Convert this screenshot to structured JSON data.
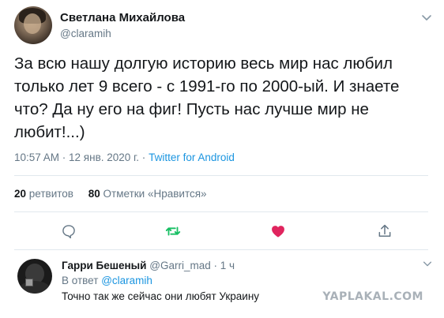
{
  "tweet": {
    "author_name": "Светлана Михайлова",
    "author_handle": "@claramih",
    "text": "За всю нашу долгую историю весь мир нас любил только лет 9 всего - с 1991-го по 2000-ый. И знаете что? Да ну его на фиг!  Пусть нас лучше мир не любит!...)",
    "time": "10:57 AM · 12 янв. 2020 г. · ",
    "source": "Twitter for Android",
    "retweets_count": "20",
    "retweets_label": "ретвитов",
    "likes_count": "80",
    "likes_label": "Отметки «Нравится»"
  },
  "actions": {
    "reply_icon": "reply-icon",
    "retweet_icon": "retweet-icon",
    "like_icon": "heart-icon",
    "share_icon": "share-icon",
    "retweet_color": "#17bf63",
    "like_color": "#e0245e"
  },
  "reply": {
    "author_name": "Гарри Бешеный",
    "author_handle": "@Garri_mad",
    "time": "· 1 ч",
    "reply_to_label": "В ответ",
    "reply_to_handle": "@claramih",
    "text": "Точно так же сейчас они любят Украину"
  },
  "watermark": "YAPLAKAL.COM",
  "colors": {
    "link": "#1b95e0",
    "secondary_text": "#657786",
    "primary_text": "#14171a"
  }
}
